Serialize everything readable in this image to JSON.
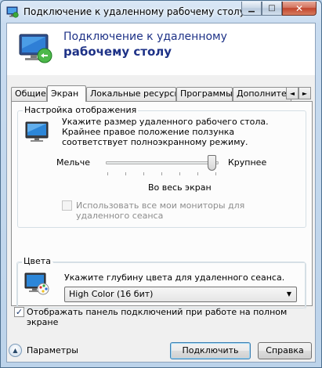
{
  "window": {
    "title": "Подключение к удаленному рабочему столу",
    "icons": {
      "app": "remote-desktop-icon",
      "minimize": "minimize-icon",
      "maximize": "maximize-icon",
      "close": "close-icon"
    }
  },
  "banner": {
    "line1": "Подключение к удаленному",
    "line2": "рабочему столу"
  },
  "tabs": {
    "items": [
      {
        "label": "Общие",
        "active": false
      },
      {
        "label": "Экран",
        "active": true
      },
      {
        "label": "Локальные ресурсы",
        "active": false
      },
      {
        "label": "Программы",
        "active": false
      },
      {
        "label": "Дополнительно",
        "active": false
      }
    ],
    "scroll_left": "◄",
    "scroll_right": "►"
  },
  "display": {
    "group_label": "Настройка отображения",
    "description": "Укажите размер удаленного рабочего стола. Крайнее правое положение ползунка соответствует полноэкранному режиму.",
    "slider_min_label": "Мельче",
    "slider_max_label": "Крупнее",
    "slider_value_label": "Во весь экран",
    "slider_position": 1.0,
    "multimon_label": "Использовать все мои мониторы для удаленного сеанса",
    "multimon_checked": false,
    "multimon_enabled": false
  },
  "colors": {
    "group_label": "Цвета",
    "description": "Укажите глубину цвета для удаленного сеанса.",
    "selected": "High Color (16 бит)"
  },
  "connection_bar": {
    "label": "Отображать панель подключений при работе на полном экране",
    "checked": true,
    "mark": "✓"
  },
  "footer": {
    "options_label": "Параметры",
    "connect_label": "Подключить",
    "help_label": "Справка"
  }
}
